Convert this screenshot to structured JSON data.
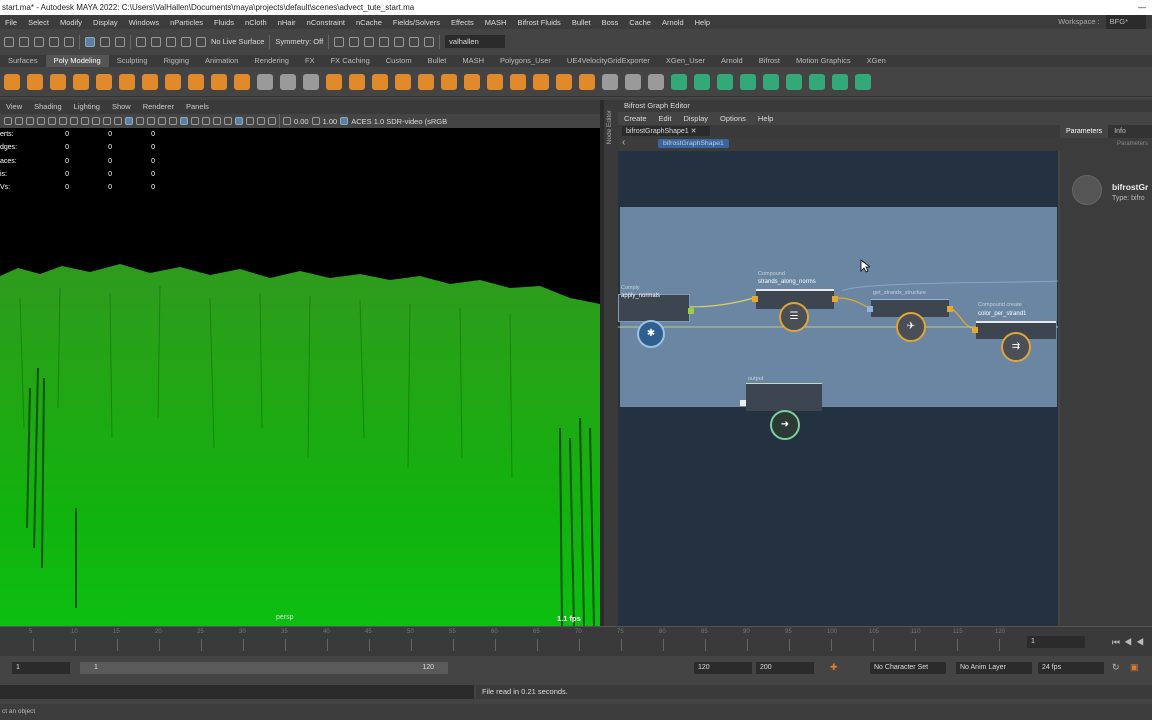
{
  "window": {
    "title": "start.ma* - Autodesk MAYA 2022: C:\\Users\\ValHallen\\Documents\\maya\\projects\\default\\scenes\\advect_tute_start.ma"
  },
  "menubar": {
    "items": [
      "File",
      "Select",
      "Modify",
      "Display",
      "Windows",
      "nParticles",
      "Fluids",
      "nCloth",
      "nHair",
      "nConstraint",
      "nCache",
      "Fields/Solvers",
      "Effects",
      "MASH",
      "Bifrost Fluids",
      "Bullet",
      "Boss",
      "Cache",
      "Arnold",
      "Help"
    ],
    "workspace_label": "Workspace :",
    "workspace_value": "BFG*"
  },
  "statusline": {
    "live_surface": "No Live Surface",
    "symmetry": "Symmetry: Off",
    "user": "valhallen"
  },
  "shelf": {
    "tabs": [
      "Surfaces",
      "Poly Modeling",
      "Sculpting",
      "Rigging",
      "Animation",
      "Rendering",
      "FX",
      "FX Caching",
      "Custom",
      "Bullet",
      "MASH",
      "Polygons_User",
      "UE4VelocityGridExporter",
      "XGen_User",
      "Arnold",
      "Bifrost",
      "Motion Graphics",
      "XGen"
    ],
    "active_tab": "Poly Modeling"
  },
  "viewport": {
    "menu": [
      "View",
      "Shading",
      "Lighting",
      "Show",
      "Renderer",
      "Panels"
    ],
    "exposure": "0.00",
    "gamma": "1.00",
    "colorspace": "ACES 1.0 SDR-video (sRGB",
    "hud": [
      {
        "label": "erts:",
        "a": "0",
        "b": "0",
        "c": "0"
      },
      {
        "label": "dges:",
        "a": "0",
        "b": "0",
        "c": "0"
      },
      {
        "label": "aces:",
        "a": "0",
        "b": "0",
        "c": "0"
      },
      {
        "label": "is:",
        "a": "0",
        "b": "0",
        "c": "0"
      },
      {
        "label": "Vs:",
        "a": "0",
        "b": "0",
        "c": "0"
      }
    ],
    "camera": "persp",
    "fps": "1.1 fps"
  },
  "node_editor_label": "Node Editor",
  "bifrost": {
    "title": "Bifrost Graph Editor",
    "menu": [
      "Create",
      "Edit",
      "Display",
      "Options",
      "Help"
    ],
    "tab": "bifrostGraphShape1",
    "breadcrumb": "bifrostGraphShape1",
    "nodes": {
      "n1_sub": "Comply",
      "n1_name": "apply_normals",
      "n2_sub": "Compound",
      "n2_name": "strands_along_norms",
      "n3_sub": "get_strands_structure",
      "n4_sub": "Compound create",
      "n4_name": "color_per_strand1",
      "n5_sub": "output"
    }
  },
  "params": {
    "tabs": [
      "Parameters",
      "Info"
    ],
    "header": "Parameters",
    "node_name": "bifrostGr",
    "node_type": "Type: bifro"
  },
  "timeslider": {
    "ticks": [
      "5",
      "10",
      "15",
      "20",
      "25",
      "30",
      "35",
      "40",
      "45",
      "50",
      "55",
      "60",
      "65",
      "70",
      "75",
      "80",
      "85",
      "90",
      "95",
      "100",
      "105",
      "110",
      "115",
      "120"
    ],
    "current_frame": "1"
  },
  "range": {
    "start": "1",
    "inner_start": "1",
    "inner_end": "120",
    "end": "120",
    "max_end": "200",
    "character_set": "No Character Set",
    "anim_layer": "No Anim Layer",
    "fps": "24 fps"
  },
  "command": {
    "result": "File read in  0.21 seconds."
  },
  "helpline": "ct an object"
}
